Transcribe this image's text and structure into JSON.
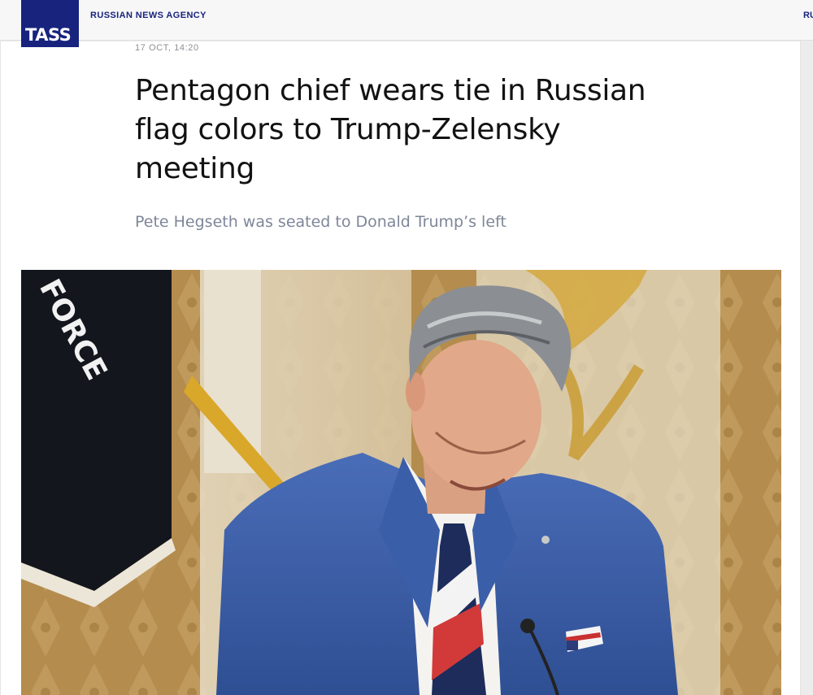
{
  "header": {
    "logo_text": "TASS",
    "agency_label": "RUSSIAN NEWS AGENCY",
    "language_switch": "RU"
  },
  "article": {
    "date": "17 OCT, 14:20",
    "headline_line1": "Pentagon chief wears tie in Russian",
    "headline_line2": "flag colors to Trump-Zelensky",
    "headline_line3": "meeting",
    "subtitle": "Pete Hegseth was seated to Donald Trump’s left"
  },
  "photo": {
    "flag_text": "FORCE"
  },
  "colors": {
    "brand": "#17237d",
    "subtitle": "#7e8698",
    "headline": "#121212"
  }
}
